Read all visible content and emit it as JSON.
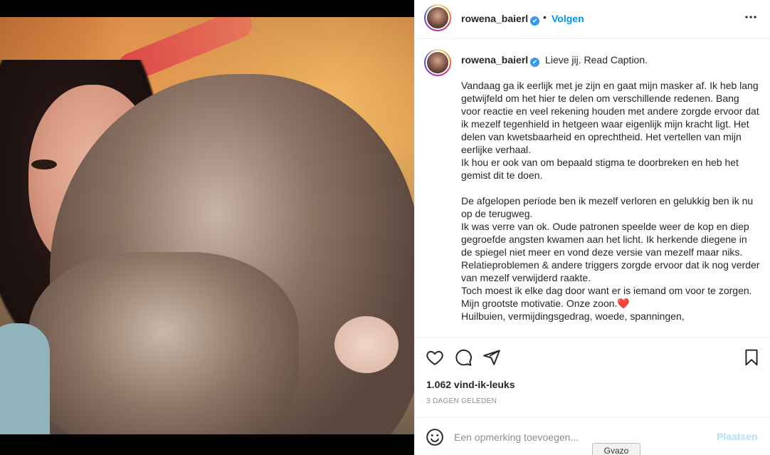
{
  "post": {
    "username": "rowena_baierl",
    "follow_label": "Volgen",
    "dot": "•",
    "more_icon": "more-horizontal-icon",
    "verified_mark": "✔"
  },
  "caption": {
    "intro": "Lieve jij. Read Caption.",
    "body": "Vandaag ga ik eerlijk met je zijn en gaat mijn masker af. Ik heb lang getwijfeld om het hier te delen om verschillende redenen. Bang voor reactie en veel rekening houden met andere zorgde ervoor dat ik mezelf tegenhield in hetgeen waar eigenlijk mijn kracht ligt. Het delen van kwetsbaarheid en oprechtheid. Het vertellen van mijn eerlijke verhaal.\nIk hou er ook van om bepaald stigma te doorbreken en heb het gemist dit te doen.\n\nDe afgelopen periode ben ik mezelf verloren en gelukkig ben ik nu op de terugweg.\nIk was verre van ok. Oude patronen speelde weer de kop en diep gegroefde angsten kwamen aan het licht. Ik herkende diegene in de spiegel niet meer en vond deze versie van mezelf maar niks.\nRelatieproblemen & andere triggers zorgde ervoor dat ik nog verder van mezelf verwijderd raakte.\nToch moest ik elke dag door want er is iemand om voor te zorgen. Mijn grootste motivatie. Onze zoon.❤️\nHuilbuien, vermijdingsgedrag, woede, spanningen,"
  },
  "stats": {
    "likes": "1.062 vind-ik-leuks",
    "age": "3 DAGEN GELEDEN"
  },
  "comment": {
    "placeholder": "Een opmerking toevoegen...",
    "post_label": "Plaatsen"
  },
  "tooltip": "Gvazo",
  "colors": {
    "accent": "#0095f6",
    "post_disabled": "#b2dffc",
    "text": "#262626",
    "muted": "#8e8e8e"
  }
}
